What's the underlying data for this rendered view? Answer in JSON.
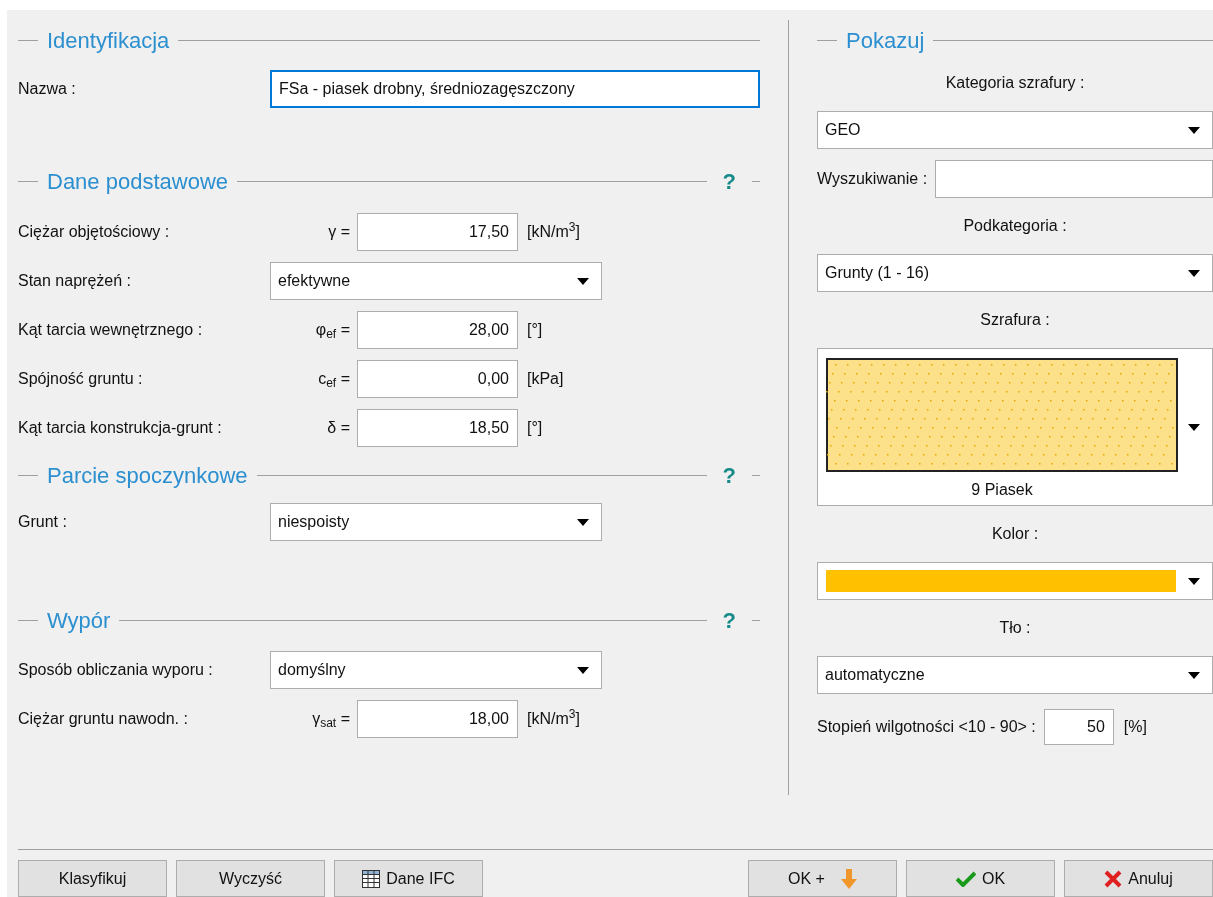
{
  "sections": [
    {
      "title": "Identyfikacja",
      "rows": [
        {
          "kind": "text",
          "label": "Nazwa :",
          "value": "FSa - piasek drobny, średniozagęszczony",
          "focused": true
        }
      ]
    },
    {
      "title": "Dane podstawowe",
      "help": "?",
      "rows": [
        {
          "kind": "number",
          "label": "Ciężar objętościowy :",
          "symbol": "γ =",
          "value": "17,50",
          "unit": "[kN/m$^{3}$]"
        },
        {
          "kind": "select",
          "label": "Stan naprężeń :",
          "value": "efektywne"
        },
        {
          "kind": "number",
          "label": "Kąt tarcia wewnętrznego :",
          "symbol": "φ$_{ef}$ =",
          "value": "28,00",
          "unit": "[°]"
        },
        {
          "kind": "number",
          "label": "Spójność gruntu :",
          "symbol": "c$_{ef}$ =",
          "value": "0,00",
          "unit": "[kPa]"
        },
        {
          "kind": "number",
          "label": "Kąt tarcia konstrukcja-grunt :",
          "symbol": "δ =",
          "value": "18,50",
          "unit": "[°]"
        }
      ]
    },
    {
      "title": "Parcie spoczynkowe",
      "help": "?",
      "rows": [
        {
          "kind": "select",
          "label": "Grunt :",
          "value": "niespoisty"
        }
      ]
    },
    {
      "title": "Wypór",
      "help": "?",
      "rows": [
        {
          "kind": "select",
          "label": "Sposób obliczania wyporu :",
          "value": "domyślny"
        },
        {
          "kind": "number",
          "label": "Ciężar gruntu nawodn. :",
          "symbol": "γ$_{sat}$ =",
          "value": "18,00",
          "unit": "[kN/m$^{3}$]"
        }
      ]
    }
  ],
  "display": {
    "title": "Pokazuj",
    "items": [
      {
        "kind": "caption",
        "text": "Kategoria szrafury :"
      },
      {
        "kind": "select",
        "value": "GEO"
      },
      {
        "kind": "search",
        "label": "Wyszukiwanie :"
      },
      {
        "kind": "caption",
        "text": "Podkategoria :"
      },
      {
        "kind": "select",
        "value": "Grunty (1 - 16)"
      },
      {
        "kind": "caption",
        "text": "Szrafura :"
      },
      {
        "kind": "hatch",
        "text": "9 Piasek"
      },
      {
        "kind": "caption",
        "text": "Kolor :"
      },
      {
        "kind": "color",
        "color": "#ffc000"
      },
      {
        "kind": "caption",
        "text": "Tło :"
      },
      {
        "kind": "select",
        "value": "automatyczne"
      },
      {
        "kind": "number",
        "label": "Stopień wilgotności <10 - 90> :",
        "value": "50",
        "unit": "[%]"
      }
    ]
  },
  "buttons_left": [
    {
      "label": "Klasyfikuj",
      "kind": "plain"
    },
    {
      "label": "Wyczyść",
      "kind": "plain"
    },
    {
      "label": "Dane IFC",
      "kind": "table"
    }
  ],
  "buttons_right": [
    {
      "label": "OK +",
      "kind": "add"
    },
    {
      "label": "OK",
      "kind": "confirm"
    },
    {
      "label": "Anuluj",
      "kind": "cancel"
    }
  ]
}
